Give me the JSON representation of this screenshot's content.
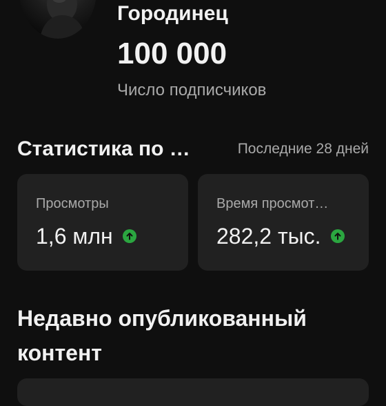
{
  "channel": {
    "name": "Городинец",
    "subscriber_count": "100 000",
    "subscriber_label": "Число подписчиков"
  },
  "stats": {
    "title": "Статистика по …",
    "period": "Последние 28 дней",
    "cards": [
      {
        "label": "Просмотры",
        "value": "1,6 млн",
        "trend": "up",
        "trend_icon": "arrow-up-icon"
      },
      {
        "label": "Время просмот…",
        "value": "282,2 тыс.",
        "trend": "up",
        "trend_icon": "arrow-up-icon"
      }
    ]
  },
  "recent": {
    "title": "Недавно опубликованный контент"
  },
  "colors": {
    "background": "#0f0f0f",
    "card": "#212121",
    "text_primary": "#f1f1f1",
    "text_secondary": "#aaaaaa",
    "trend_up": "#2ba640"
  }
}
